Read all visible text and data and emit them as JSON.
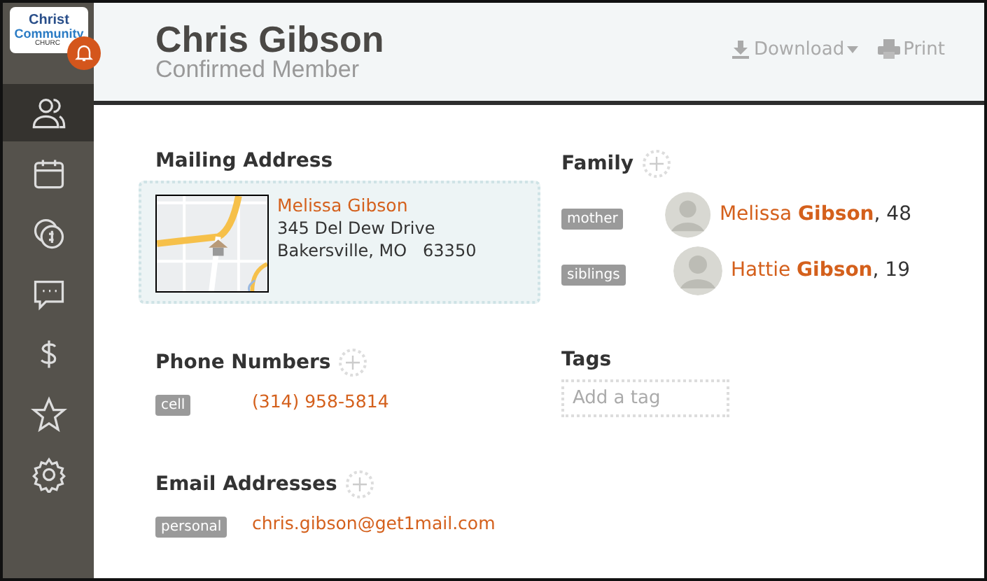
{
  "logo": {
    "line1": "Christ",
    "line2": "Community",
    "line3": "CHURC"
  },
  "sidebar": {
    "items": [
      {
        "selected": true
      },
      {
        "selected": false
      },
      {
        "selected": false
      },
      {
        "selected": false
      },
      {
        "selected": false
      },
      {
        "selected": false
      },
      {
        "selected": false
      }
    ]
  },
  "header": {
    "name": "Chris Gibson",
    "status": "Confirmed Member",
    "actions": [
      {
        "kind": "download",
        "label": "Download"
      },
      {
        "kind": "print",
        "label": "Print"
      }
    ]
  },
  "mailing": {
    "title": "Mailing Address",
    "recipient": "Melissa Gibson",
    "street": "345 Del Dew Drive",
    "city": "Bakersville, MO   63350"
  },
  "phones": {
    "title": "Phone Numbers",
    "items": [
      {
        "tag": "cell",
        "value": "(314) 958-5814"
      }
    ]
  },
  "emails": {
    "title": "Email Addresses",
    "items": [
      {
        "tag": "personal",
        "value": "chris.gibson@get1mail.com"
      }
    ]
  },
  "family": {
    "title": "Family",
    "members": [
      {
        "relation": "mother",
        "name": "Melissa **Gibson**",
        "age": ", 48"
      },
      {
        "relation": "siblings",
        "name": "Hattie **Gibson**",
        "age": ", 19"
      }
    ]
  },
  "tags": {
    "title": "Tags",
    "placeholder": "Add a tag"
  }
}
